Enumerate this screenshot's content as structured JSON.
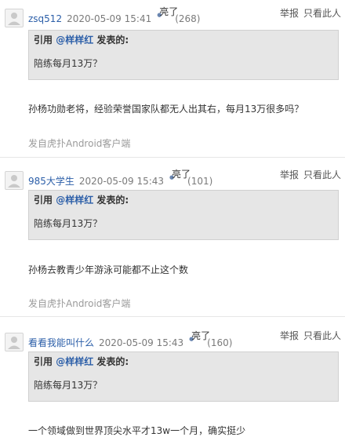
{
  "posts": [
    {
      "user": "zsq512",
      "time": "2020-05-09 15:41",
      "light_label": "亮了",
      "light_count": "(268)",
      "report": "举报",
      "only_this": "只看此人",
      "quote_prefix": "引用",
      "quote_user": "@样样红",
      "quote_suffix": "发表的:",
      "quote_text": "陪练每月13万？",
      "content": "孙杨功勋老将，经验荣誉国家队都无人出其右，每月13万很多吗？",
      "source": "发自虎扑Android客户端"
    },
    {
      "user": "985大学生",
      "time": "2020-05-09 15:43",
      "light_label": "亮了",
      "light_count": "(101)",
      "report": "举报",
      "only_this": "只看此人",
      "quote_prefix": "引用",
      "quote_user": "@样样红",
      "quote_suffix": "发表的:",
      "quote_text": "陪练每月13万？",
      "content": "孙杨去教青少年游泳可能都不止这个数",
      "source": "发自虎扑Android客户端"
    },
    {
      "user": "看看我能叫什么",
      "time": "2020-05-09 15:43",
      "light_label": "亮了",
      "light_count": "(160)",
      "report": "举报",
      "only_this": "只看此人",
      "quote_prefix": "引用",
      "quote_user": "@样样红",
      "quote_suffix": "发表的:",
      "quote_text": "陪练每月13万？",
      "content": "一个领域做到世界顶尖水平才13w一个月，确实挺少"
    }
  ]
}
